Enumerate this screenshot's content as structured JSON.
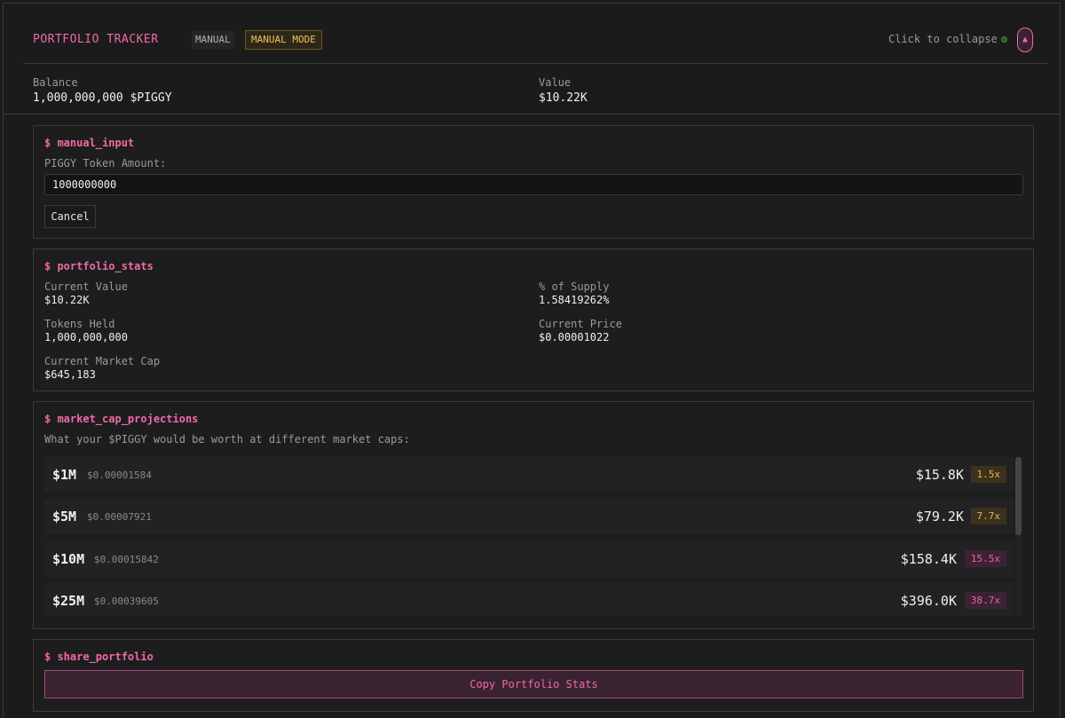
{
  "header": {
    "title": "PORTFOLIO TRACKER",
    "badge_manual": "MANUAL",
    "badge_mode": "MANUAL MODE",
    "collapse_text": "Click to collapse",
    "collapse_icon": "▲"
  },
  "summary": {
    "balance_label": "Balance",
    "balance_value": "1,000,000,000 $PIGGY",
    "value_label": "Value",
    "value_value": "$10.22K"
  },
  "manual_input": {
    "title": "$ manual_input",
    "field_label": "PIGGY Token Amount:",
    "field_value": "1000000000",
    "cancel_label": "Cancel"
  },
  "portfolio_stats": {
    "title": "$ portfolio_stats",
    "current_value_label": "Current Value",
    "current_value": "$10.22K",
    "supply_label": "% of Supply",
    "supply_value": "1.58419262%",
    "tokens_held_label": "Tokens Held",
    "tokens_held": "1,000,000,000",
    "current_price_label": "Current Price",
    "current_price": "$0.00001022",
    "market_cap_label": "Current Market Cap",
    "market_cap": "$645,183"
  },
  "projections": {
    "title": "$ market_cap_projections",
    "subtitle": "What your $PIGGY would be worth at different market caps:",
    "rows": [
      {
        "cap": "$1M",
        "price": "$0.00001584",
        "value": "$15.8K",
        "multiplier": "1.5x",
        "tone": "gold"
      },
      {
        "cap": "$5M",
        "price": "$0.00007921",
        "value": "$79.2K",
        "multiplier": "7.7x",
        "tone": "gold"
      },
      {
        "cap": "$10M",
        "price": "$0.00015842",
        "value": "$158.4K",
        "multiplier": "15.5x",
        "tone": "pink"
      },
      {
        "cap": "$25M",
        "price": "$0.00039605",
        "value": "$396.0K",
        "multiplier": "38.7x",
        "tone": "pink"
      }
    ]
  },
  "share": {
    "title": "$ share_portfolio",
    "copy_label": "Copy Portfolio Stats"
  },
  "colors": {
    "accent": "#f06aa8",
    "gold": "#e2b652",
    "background": "#1b1b1b"
  }
}
